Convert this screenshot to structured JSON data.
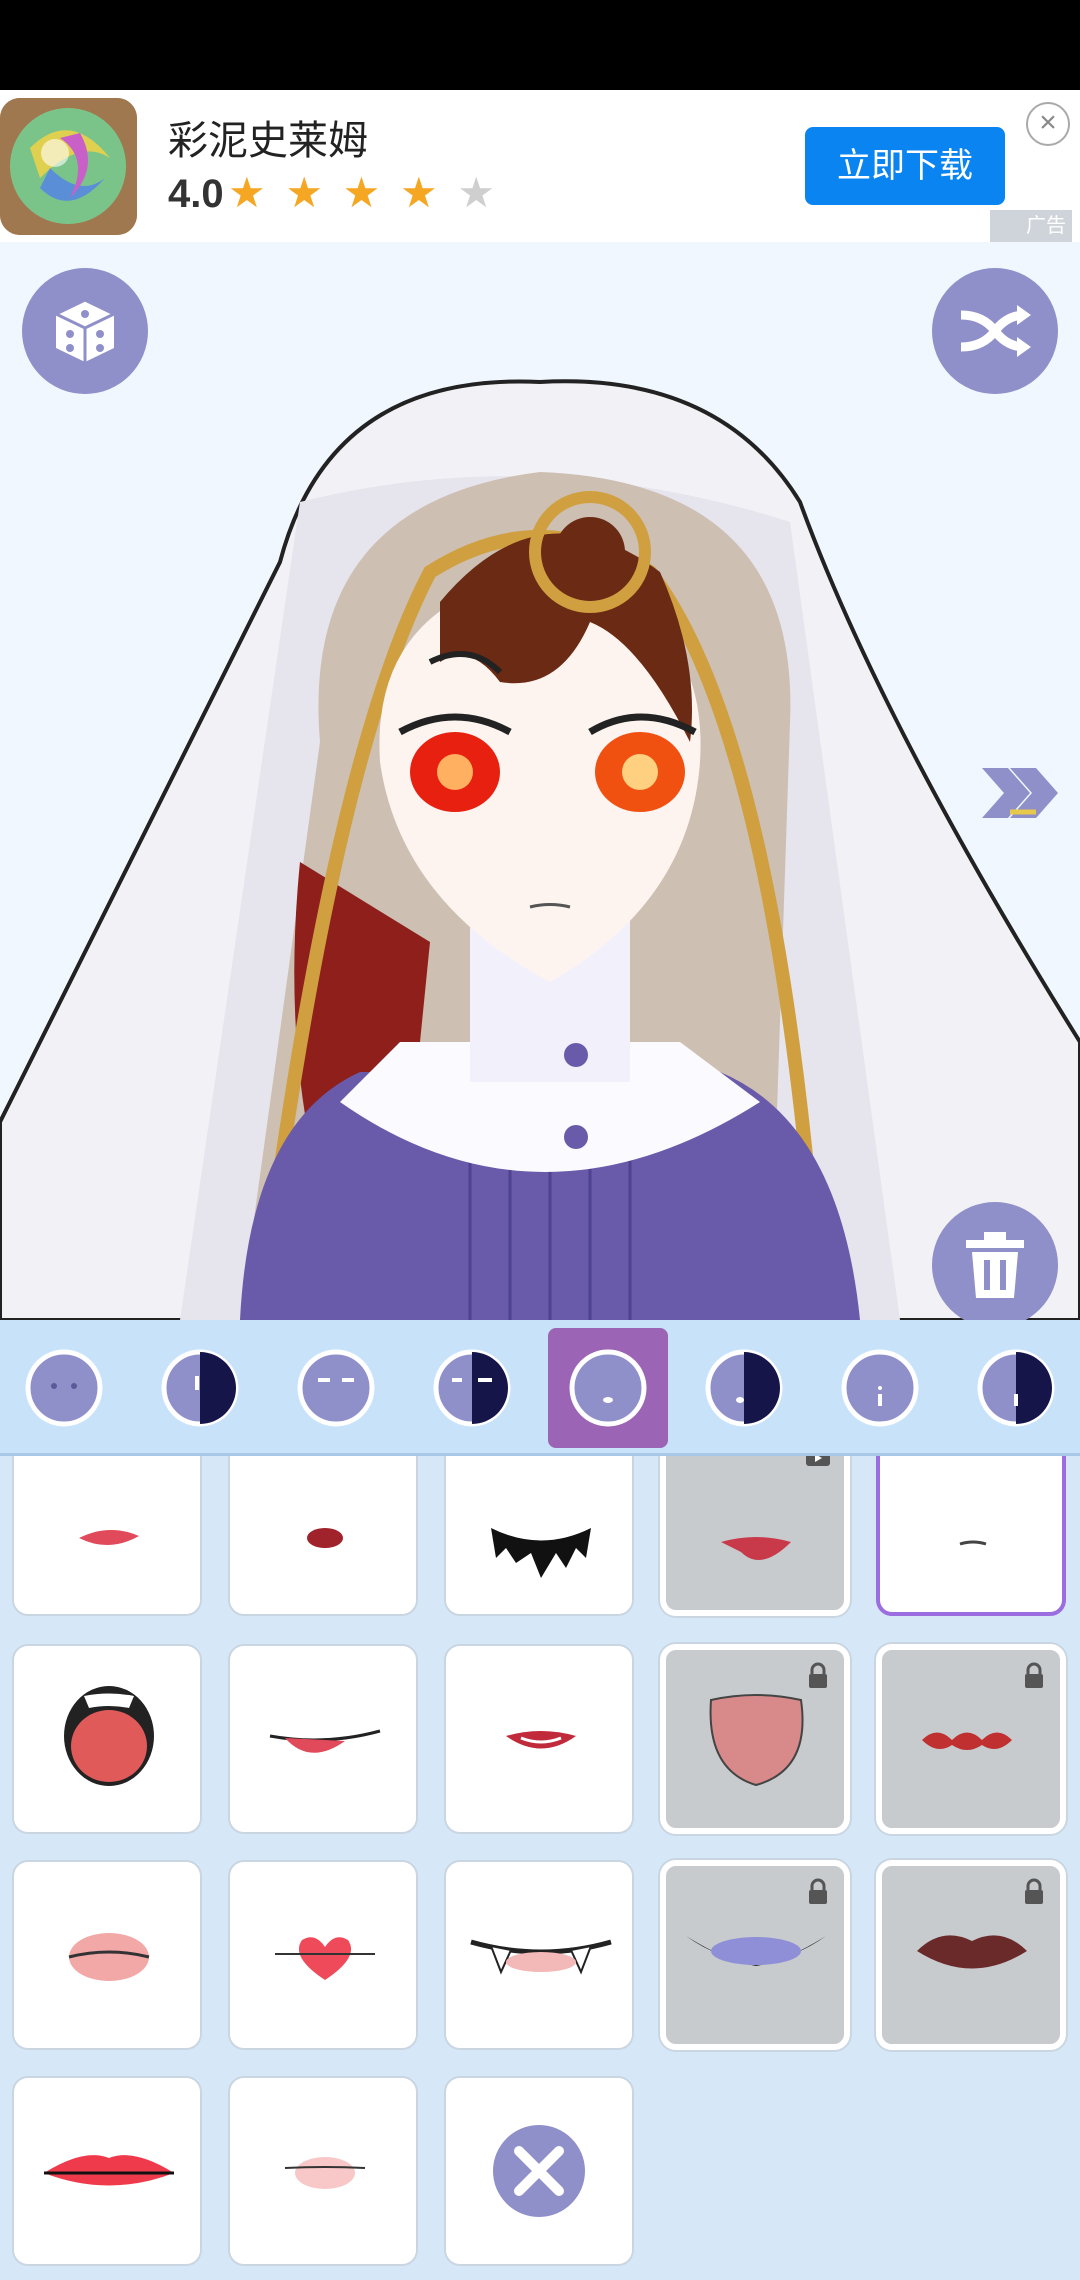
{
  "ad": {
    "app_name": "彩泥史莱姆",
    "rating": "4.0",
    "stars_filled": 4,
    "stars_total": 5,
    "download_label": "立即下载",
    "badge_label": "广告"
  },
  "colors": {
    "accent": "#8f8fca",
    "active_tab": "#9b64b4",
    "selected_border": "#9b6de0",
    "ad_button": "#0a84f0",
    "tab_strip_bg": "#c7e2f9",
    "grid_bg": "#d6e8f8"
  },
  "toolbar": {
    "random_icon": "dice-icon",
    "shuffle_icon": "shuffle-icon",
    "next_icon": "double-chevron-right-icon",
    "delete_icon": "trash-icon"
  },
  "tabs": [
    {
      "name": "tab-face-1",
      "active": false
    },
    {
      "name": "tab-face-2",
      "active": false
    },
    {
      "name": "tab-face-3",
      "active": false
    },
    {
      "name": "tab-face-4",
      "active": false
    },
    {
      "name": "tab-face-5",
      "active": true
    },
    {
      "name": "tab-face-6",
      "active": false
    },
    {
      "name": "tab-face-7",
      "active": false
    },
    {
      "name": "tab-face-8",
      "active": false
    }
  ],
  "mouth_items": [
    {
      "state": "free"
    },
    {
      "state": "free"
    },
    {
      "state": "free"
    },
    {
      "state": "video"
    },
    {
      "state": "selected"
    },
    {
      "state": "free"
    },
    {
      "state": "free"
    },
    {
      "state": "free"
    },
    {
      "state": "locked"
    },
    {
      "state": "locked"
    },
    {
      "state": "free"
    },
    {
      "state": "free"
    },
    {
      "state": "free"
    },
    {
      "state": "locked"
    },
    {
      "state": "locked"
    },
    {
      "state": "free"
    },
    {
      "state": "free"
    },
    {
      "state": "none"
    }
  ]
}
